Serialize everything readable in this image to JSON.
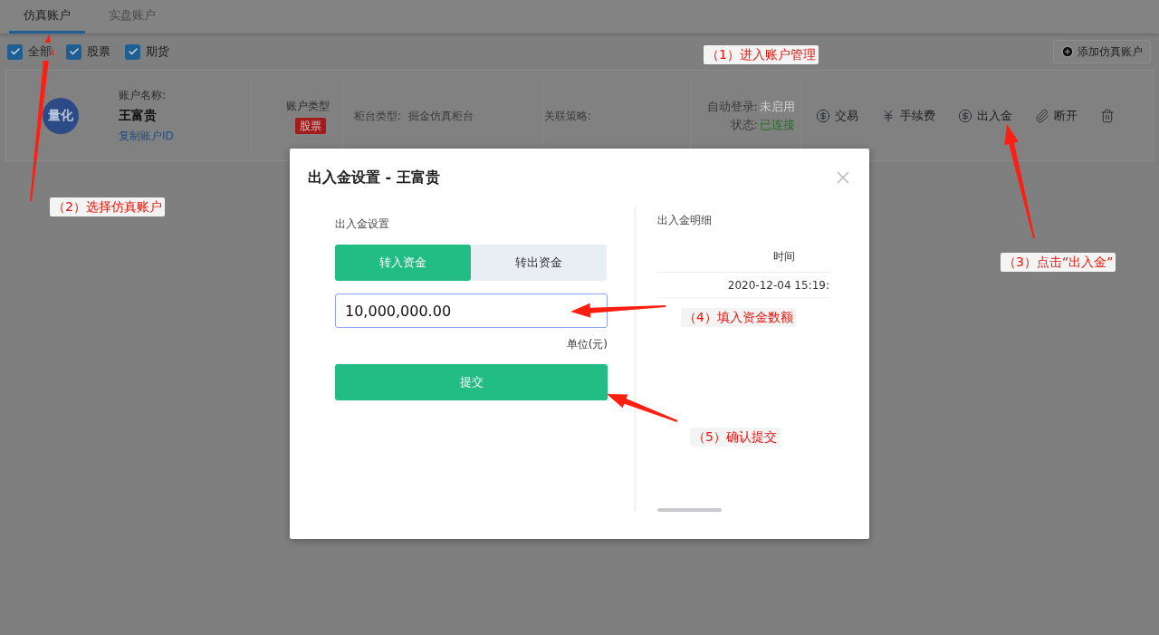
{
  "tabs": [
    {
      "label": "仿真账户",
      "selected": true
    },
    {
      "label": "实盘账户",
      "selected": false
    }
  ],
  "filters": [
    {
      "label": "全部",
      "checked": true
    },
    {
      "label": "股票",
      "checked": true
    },
    {
      "label": "期货",
      "checked": true
    }
  ],
  "add_button": "添加仿真账户",
  "account": {
    "avatar_text": "量化",
    "name_label": "账户名称:",
    "name": "王富贵",
    "copy_link": "复制账户ID",
    "type_label": "账户类型",
    "type_badge": "股票",
    "counter_label": "柜台类型:",
    "counter_value": "掘金仿真柜台",
    "strategy_label": "关联策略:",
    "auto_login_label": "自动登录:",
    "auto_login_value": "未启用",
    "status_label": "状态:",
    "status_value": "已连接",
    "actions": [
      {
        "kind": "dollar",
        "label": "交易"
      },
      {
        "kind": "yen",
        "label": "手续费"
      },
      {
        "kind": "dollar",
        "label": "出入金"
      },
      {
        "kind": "clip",
        "label": "断开"
      },
      {
        "kind": "trash"
      }
    ]
  },
  "modal": {
    "title": "出入金设置 - 王富贵",
    "left_title": "出入金设置",
    "mode_tabs": [
      {
        "label": "转入资金",
        "selected": true
      },
      {
        "label": "转出资金",
        "selected": false
      }
    ],
    "amount_value": "10,000,000.00",
    "unit": "单位(元)",
    "submit": "提交",
    "right_title": "出入金明细",
    "column_1": "时间",
    "row_1": "2020-12-04 15:19:"
  },
  "annotations": [
    "（1）进入账户管理",
    "（2）选择仿真账户",
    "（3）点击“出入金”",
    "（4）填入资金数额",
    "（5）确认提交"
  ]
}
